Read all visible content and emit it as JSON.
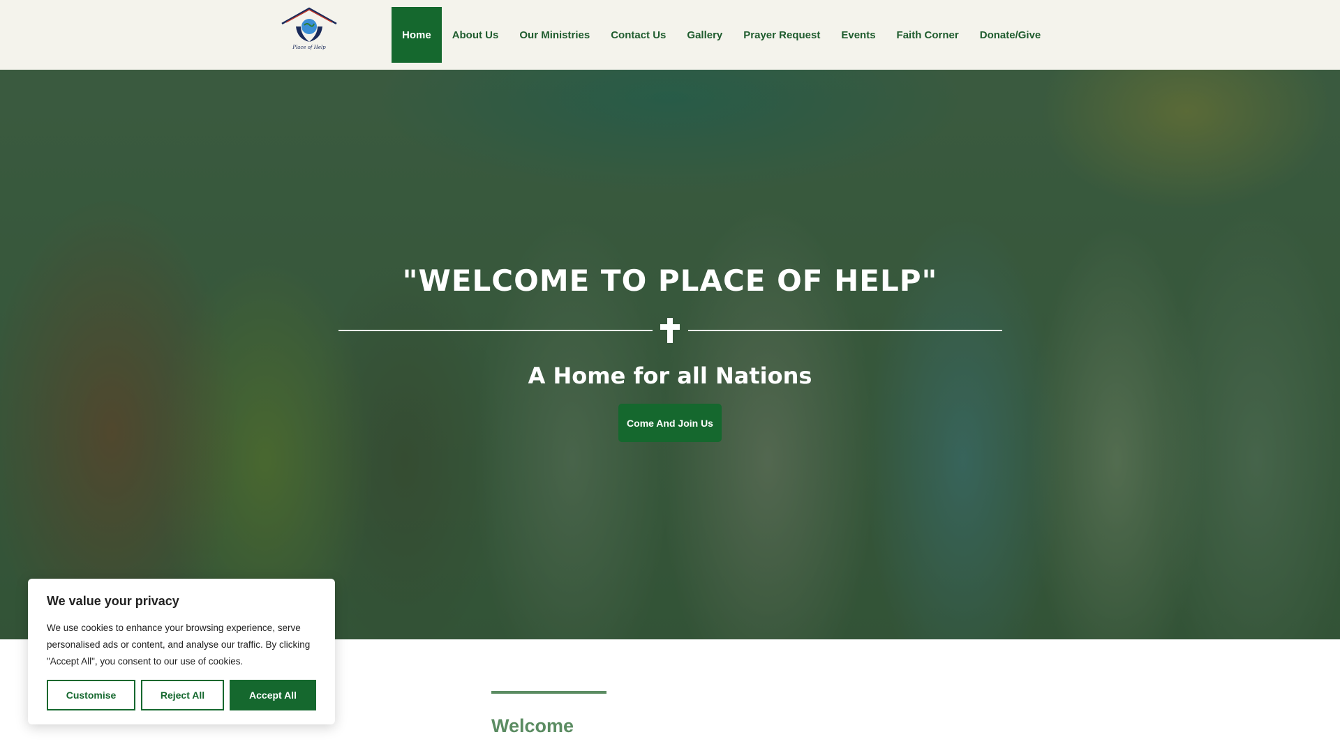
{
  "logo": {
    "text": "Place of Help"
  },
  "nav": {
    "items": [
      {
        "label": "Home",
        "active": true
      },
      {
        "label": "About Us"
      },
      {
        "label": "Our Ministries"
      },
      {
        "label": "Contact Us"
      },
      {
        "label": "Gallery"
      },
      {
        "label": "Prayer Request"
      },
      {
        "label": "Events"
      },
      {
        "label": "Faith Corner"
      },
      {
        "label": "Donate/Give"
      }
    ]
  },
  "hero": {
    "title": "\"WELCOME TO PLACE OF HELP\"",
    "subtitle": "A Home for all Nations",
    "button_label": "Come And Join Us",
    "divider_icon": "cross-icon"
  },
  "welcome": {
    "heading": "Welcome"
  },
  "cookie": {
    "title": "We value your privacy",
    "text": "We use cookies to enhance your browsing experience, serve personalised ads or content, and analyse our traffic. By clicking \"Accept All\", you consent to our use of cookies.",
    "customise_label": "Customise",
    "reject_label": "Reject All",
    "accept_label": "Accept All"
  },
  "colors": {
    "brand_green": "#15682e",
    "header_bg": "#f4f3ec",
    "welcome_green": "#5b8c62"
  }
}
